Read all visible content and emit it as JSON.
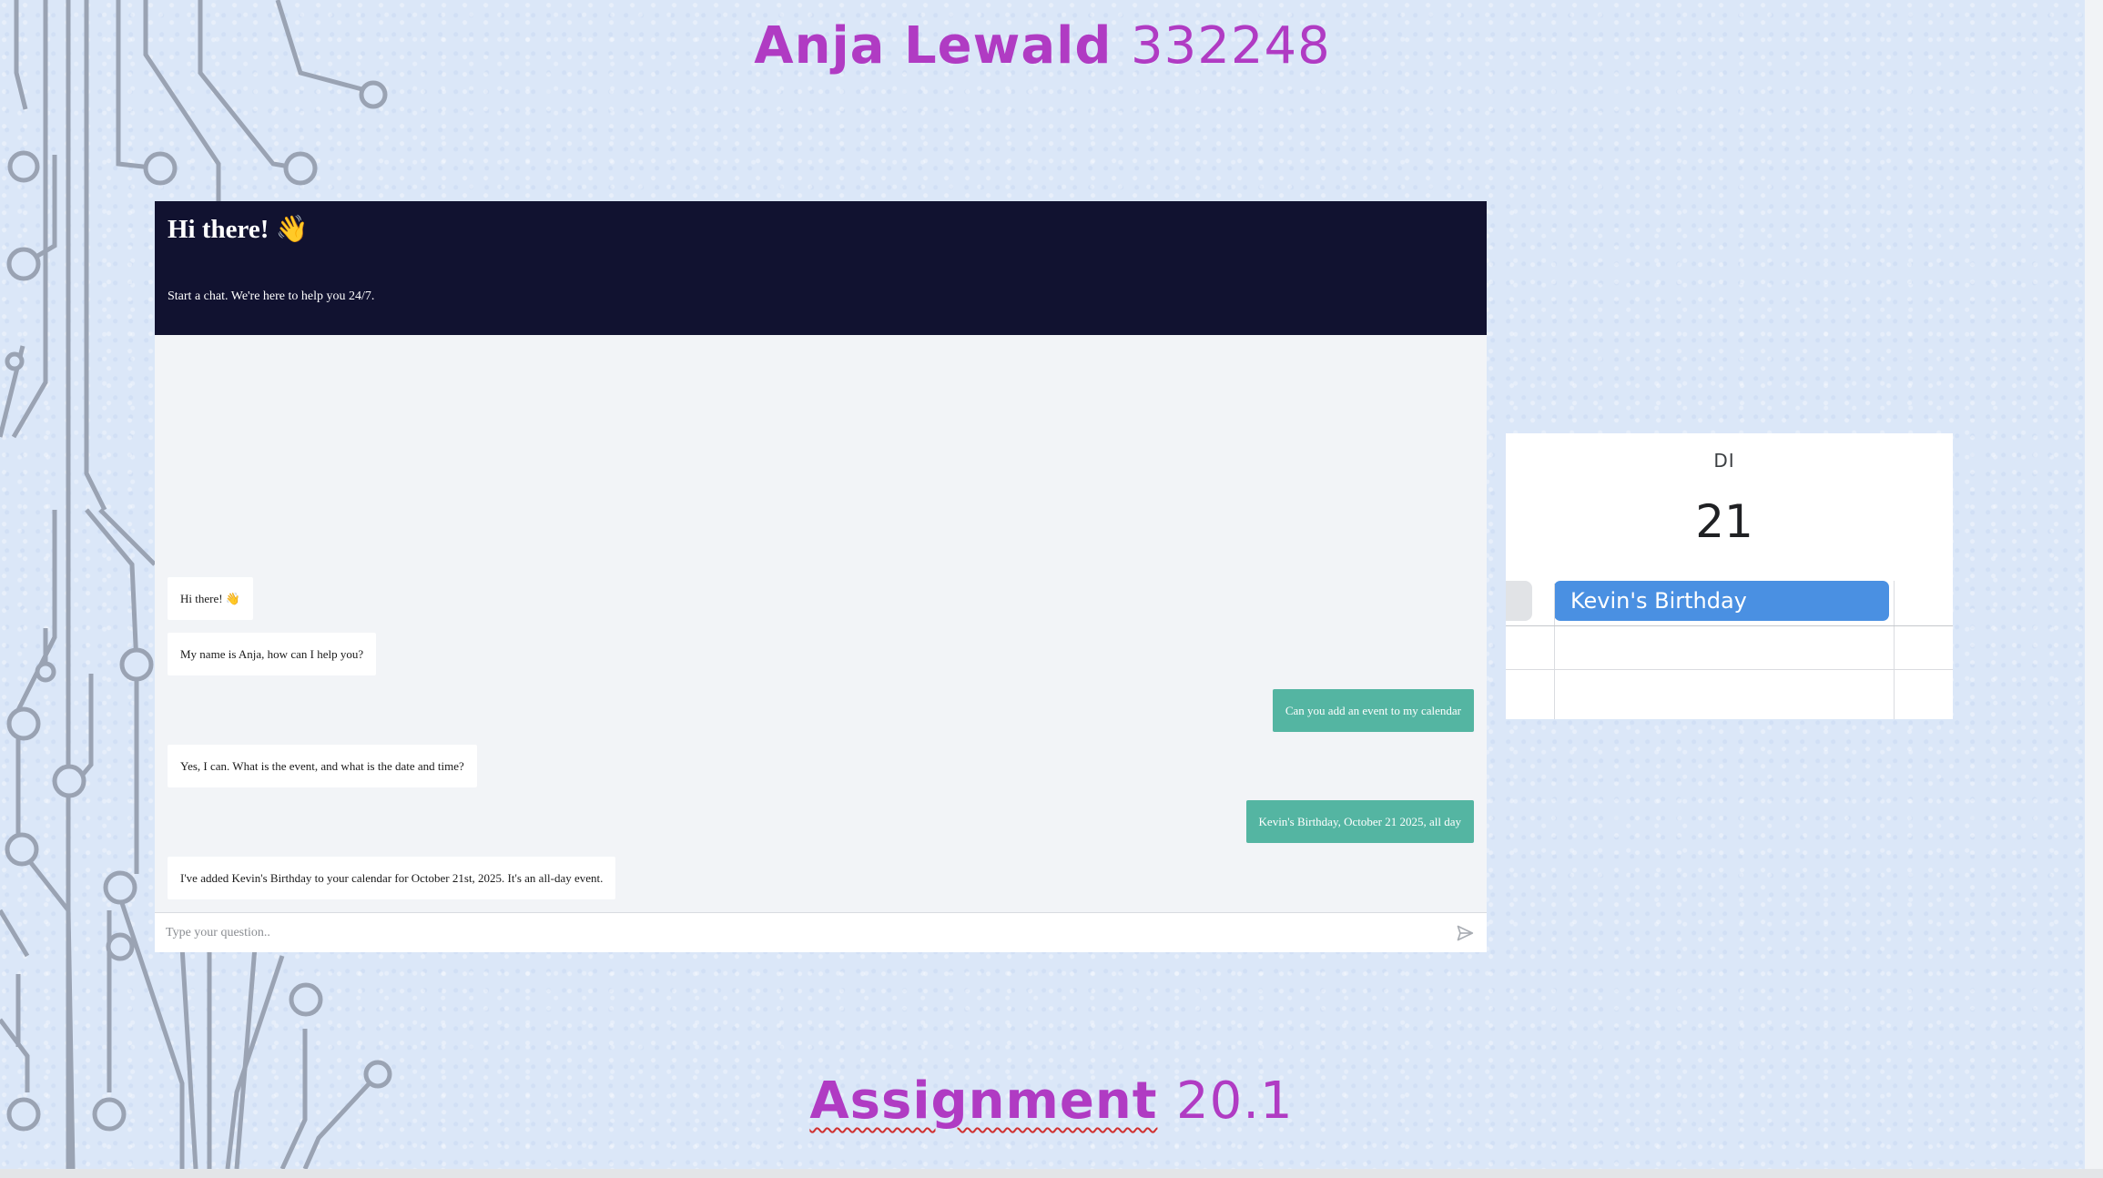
{
  "slide": {
    "title_name": "Anja Lewald",
    "title_number": "332248",
    "subtitle_word": "Assignment",
    "subtitle_number": "20.1"
  },
  "chat": {
    "header_title": "Hi there! 👋",
    "header_subtitle": "Start a chat. We're here to help you 24/7.",
    "messages": [
      {
        "sender": "bot",
        "text": "Hi there! 👋"
      },
      {
        "sender": "bot",
        "text": "My name is Anja, how can I help you?"
      },
      {
        "sender": "user",
        "text": "Can you add an event to my calendar"
      },
      {
        "sender": "bot",
        "text": "Yes, I can. What is the event, and what is the date and time?"
      },
      {
        "sender": "user",
        "text": "Kevin's Birthday, October 21 2025, all day"
      },
      {
        "sender": "bot",
        "text": "I've added Kevin's Birthday to your calendar for October 21st, 2025. It's an all-day event."
      }
    ],
    "input_placeholder": "Type your question..",
    "colors": {
      "header": "#111230",
      "user_bubble": "#54b5a2",
      "bot_bubble": "#ffffff"
    }
  },
  "calendar": {
    "day_label": "DI",
    "date_number": "21",
    "event_title": "Kevin's Birthday",
    "event_color": "#4a90e2"
  },
  "colors": {
    "title": "#b03bc3",
    "background": "#dbe7f8"
  }
}
